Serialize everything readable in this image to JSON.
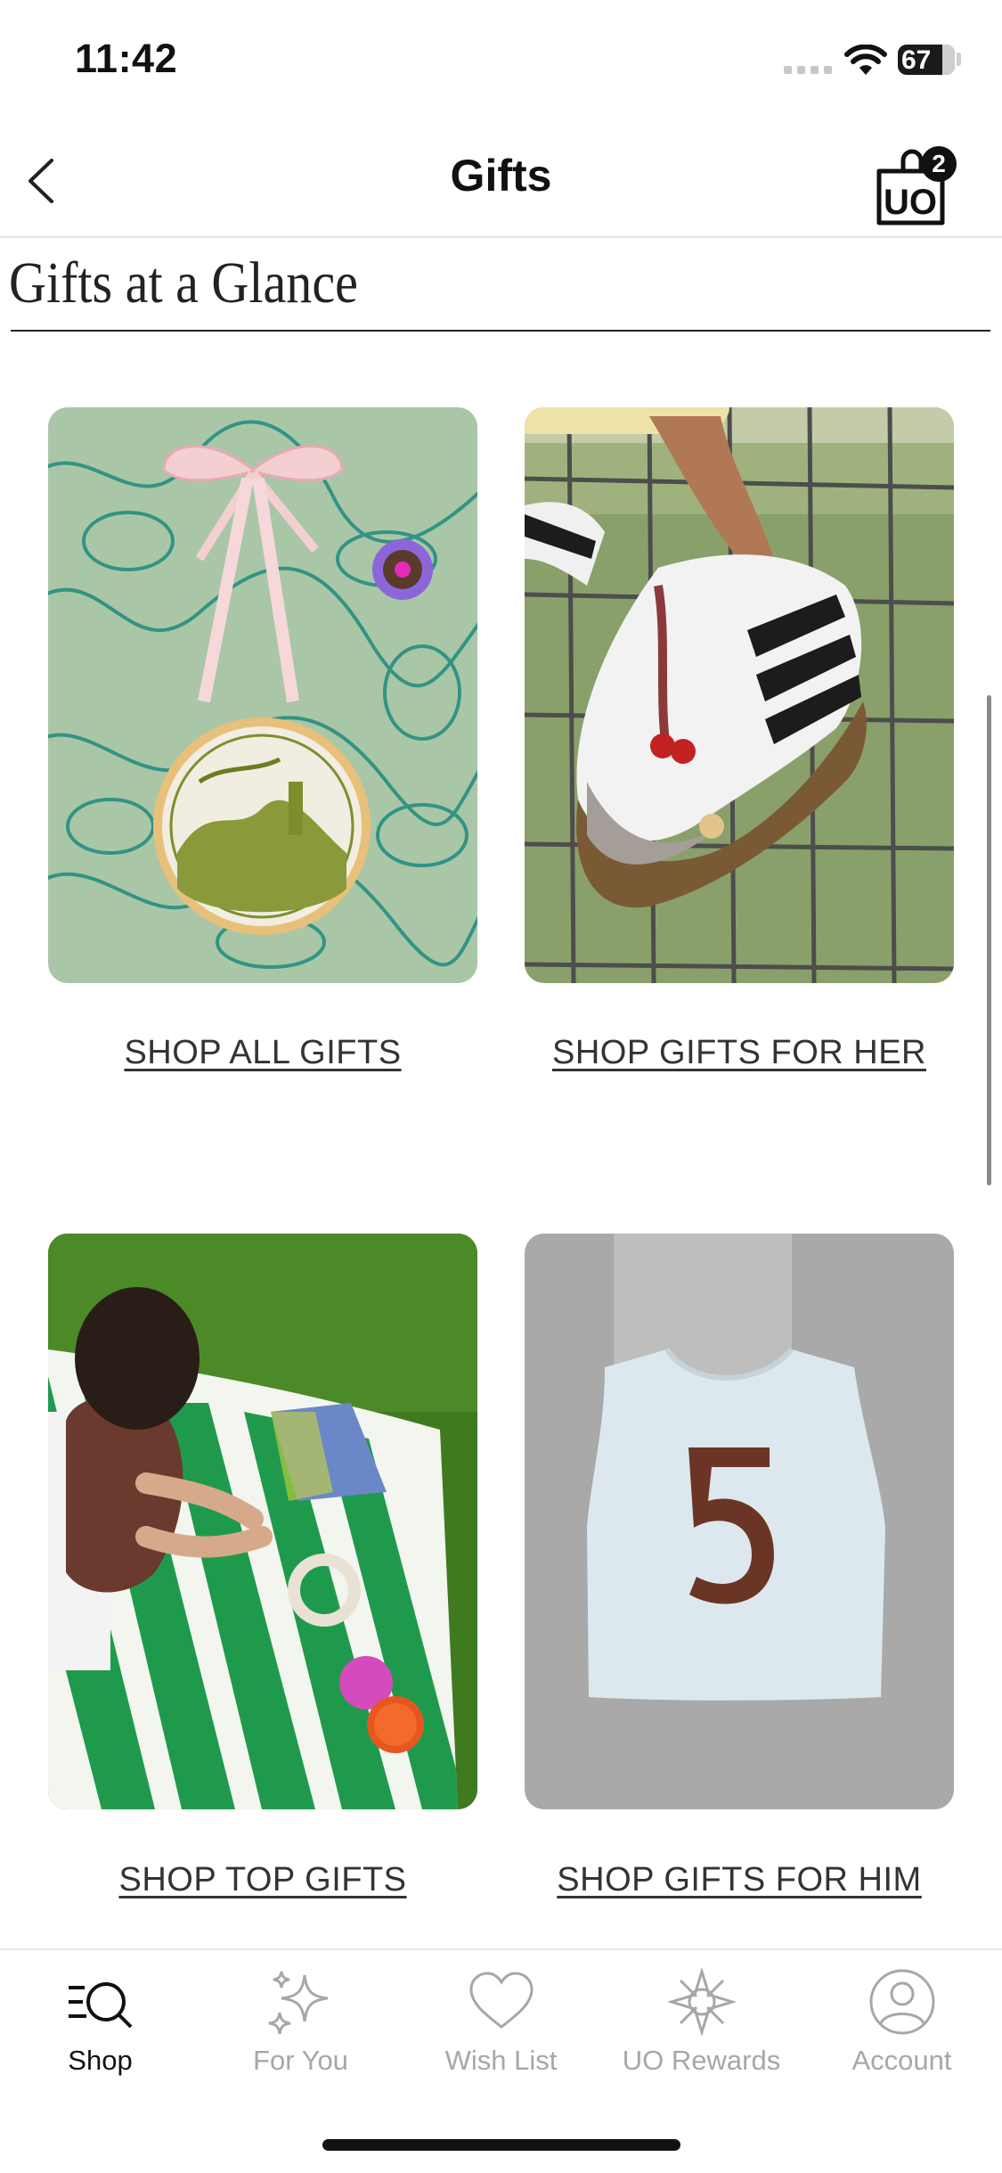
{
  "status_bar": {
    "time": "11:42",
    "battery": "67"
  },
  "header": {
    "title": "Gifts",
    "cart_count": "2",
    "cart_logo": "UO"
  },
  "section": {
    "title": "Gifts at a Glance"
  },
  "tiles": [
    {
      "label": "SHOP ALL GIFTS"
    },
    {
      "label": "SHOP GIFTS FOR HER"
    },
    {
      "label": "SHOP TOP GIFTS"
    },
    {
      "label": "SHOP GIFTS FOR HIM"
    }
  ],
  "tab_bar": {
    "items": [
      {
        "label": "Shop",
        "icon": "search-menu-icon",
        "active": true
      },
      {
        "label": "For You",
        "icon": "sparkle-icon",
        "active": false
      },
      {
        "label": "Wish List",
        "icon": "heart-icon",
        "active": false
      },
      {
        "label": "UO Rewards",
        "icon": "rewards-star-icon",
        "active": false
      },
      {
        "label": "Account",
        "icon": "person-icon",
        "active": false
      }
    ]
  },
  "colors": {
    "accent": "#111111",
    "inactive": "#a7a7a7",
    "divider": "#e3e3e3"
  }
}
